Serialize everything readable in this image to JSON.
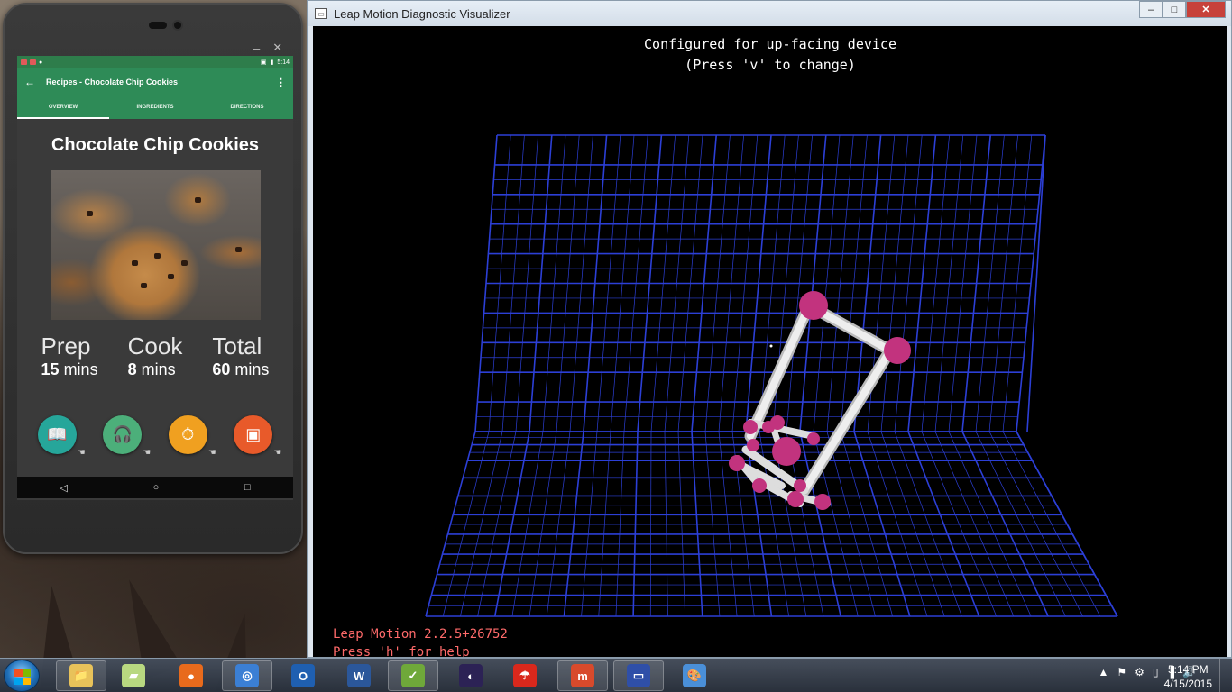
{
  "phone": {
    "emulator_controls": {
      "minimize": "–",
      "close": "✕"
    },
    "status_bar": {
      "time": "5:14"
    },
    "app_bar": {
      "back_icon": "←",
      "title": "Recipes - Chocolate Chip Cookies",
      "menu_icon": "⋮"
    },
    "tabs": [
      {
        "label": "OVERVIEW",
        "active": true
      },
      {
        "label": "INGREDIENTS",
        "active": false
      },
      {
        "label": "DIRECTIONS",
        "active": false
      }
    ],
    "recipe": {
      "title": "Chocolate Chip Cookies",
      "times": [
        {
          "label": "Prep",
          "value": "15",
          "unit": "mins"
        },
        {
          "label": "Cook",
          "value": "8",
          "unit": "mins"
        },
        {
          "label": "Total",
          "value": "60",
          "unit": "mins"
        }
      ]
    },
    "action_icons": [
      {
        "name": "book-icon",
        "glyph": "📖",
        "color": "#26a69a"
      },
      {
        "name": "headphones-icon",
        "glyph": "🎧",
        "color": "#4caf7a"
      },
      {
        "name": "timer-icon",
        "glyph": "⏱",
        "color": "#f0a020"
      },
      {
        "name": "oven-icon",
        "glyph": "▣",
        "color": "#e85a2a"
      }
    ],
    "nav": {
      "back": "◁",
      "home": "○",
      "recents": "□"
    }
  },
  "leap_window": {
    "title": "Leap Motion Diagnostic Visualizer",
    "header_line1": "Configured for up-facing device",
    "header_line2": "(Press 'v' to change)",
    "footer_line1": "Leap Motion 2.2.5+26752",
    "footer_line2": "Press 'h' for help",
    "grid_color": "#2c3fd6",
    "joint_color": "#c2337e",
    "bone_color": "#e8e8e8",
    "window_buttons": {
      "minimize": "–",
      "maximize": "□",
      "close": "✕"
    }
  },
  "taskbar": {
    "pinned": [
      {
        "name": "file-explorer-icon",
        "glyph": "📁",
        "color": "#e8c25a"
      },
      {
        "name": "maps-icon",
        "glyph": "▰",
        "color": "#b8d880"
      },
      {
        "name": "firefox-icon",
        "glyph": "●",
        "color": "#e86a1c"
      },
      {
        "name": "chrome-icon",
        "glyph": "◎",
        "color": "#3b7fd4"
      },
      {
        "name": "outlook-icon",
        "glyph": "O",
        "color": "#1f5fb0"
      },
      {
        "name": "word-icon",
        "glyph": "W",
        "color": "#2b579a"
      },
      {
        "name": "spreadsheet-icon",
        "glyph": "✓",
        "color": "#6fa83a"
      },
      {
        "name": "eclipse-icon",
        "glyph": "◐",
        "color": "#2c2255"
      },
      {
        "name": "acrobat-icon",
        "glyph": "☂",
        "color": "#d9281c"
      },
      {
        "name": "app-m-icon",
        "glyph": "m",
        "color": "#d84a2c"
      },
      {
        "name": "leap-visualizer-icon",
        "glyph": "▭",
        "color": "#2f4fa8"
      },
      {
        "name": "paint-icon",
        "glyph": "🎨",
        "color": "#4a8fd8"
      }
    ],
    "tray_icons": [
      "▲",
      "⚑",
      "⚙",
      "▯",
      "▐",
      "🔊"
    ],
    "time": "5:14 PM",
    "date": "4/15/2015"
  }
}
